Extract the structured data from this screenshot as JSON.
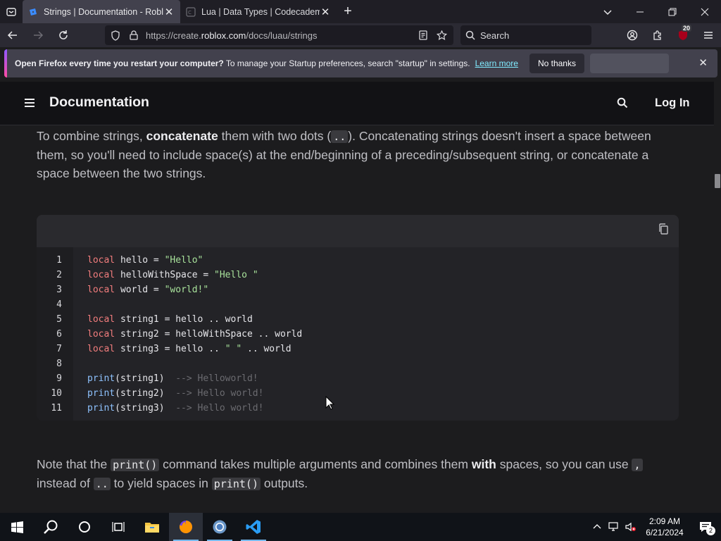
{
  "browser": {
    "tabs": [
      {
        "title": "Strings | Documentation - Roblox",
        "active": true
      },
      {
        "title": "Lua | Data Types | Codecademy",
        "active": false
      }
    ],
    "url_prefix": "https://create.",
    "url_host": "roblox.com",
    "url_path": "/docs/luau/strings",
    "search_placeholder": "Search",
    "extension_badge": "20"
  },
  "notification": {
    "bold_text": "Open Firefox every time you restart your computer?",
    "text": "To manage your Startup preferences, search \"startup\" in settings.",
    "link": "Learn more",
    "button": "No thanks"
  },
  "site": {
    "title": "Documentation",
    "login": "Log In"
  },
  "content": {
    "para1": {
      "a": "To combine strings, ",
      "b": "concatenate",
      "c": " them with two dots (",
      "code": "..",
      "d": "). Concatenating strings doesn't insert a space between them, so you'll need to include space(s) at the end/beginning of a preceding/subsequent string, or concatenate a space between the two strings."
    },
    "code_lines": [
      {
        "n": "1",
        "parts": [
          [
            "kw",
            "local"
          ],
          [
            "t",
            " hello = "
          ],
          [
            "str",
            "\"Hello\""
          ]
        ]
      },
      {
        "n": "2",
        "parts": [
          [
            "kw",
            "local"
          ],
          [
            "t",
            " helloWithSpace = "
          ],
          [
            "str",
            "\"Hello \""
          ]
        ]
      },
      {
        "n": "3",
        "parts": [
          [
            "kw",
            "local"
          ],
          [
            "t",
            " world = "
          ],
          [
            "str",
            "\"world!\""
          ]
        ]
      },
      {
        "n": "4",
        "parts": []
      },
      {
        "n": "5",
        "parts": [
          [
            "kw",
            "local"
          ],
          [
            "t",
            " string1 = hello .. world"
          ]
        ]
      },
      {
        "n": "6",
        "parts": [
          [
            "kw",
            "local"
          ],
          [
            "t",
            " string2 = helloWithSpace .. world"
          ]
        ]
      },
      {
        "n": "7",
        "parts": [
          [
            "kw",
            "local"
          ],
          [
            "t",
            " string3 = hello .. "
          ],
          [
            "str",
            "\" \""
          ],
          [
            "t",
            " .. world"
          ]
        ]
      },
      {
        "n": "8",
        "parts": []
      },
      {
        "n": "9",
        "parts": [
          [
            "fn",
            "print"
          ],
          [
            "t",
            "(string1)  "
          ],
          [
            "cm",
            "--> Helloworld!"
          ]
        ]
      },
      {
        "n": "10",
        "parts": [
          [
            "fn",
            "print"
          ],
          [
            "t",
            "(string2)  "
          ],
          [
            "cm",
            "--> Hello world!"
          ]
        ]
      },
      {
        "n": "11",
        "parts": [
          [
            "fn",
            "print"
          ],
          [
            "t",
            "(string3)  "
          ],
          [
            "cm",
            "--> Hello world!"
          ]
        ]
      }
    ],
    "para2": {
      "a": "Note that the ",
      "code1": "print()",
      "b": " command takes multiple arguments and combines them ",
      "bold": "with",
      "c": " spaces, so you can use ",
      "code2": ",",
      "d": " instead of ",
      "code3": "..",
      "e": " to yield spaces in ",
      "code4": "print()",
      "f": " outputs."
    }
  },
  "taskbar": {
    "time": "2:09 AM",
    "date": "6/21/2024",
    "notification_count": "2"
  },
  "colors": {
    "keyword": "#f27d7d",
    "string": "#a8e29b",
    "function": "#8fc3ff",
    "comment": "#6b6b70"
  }
}
